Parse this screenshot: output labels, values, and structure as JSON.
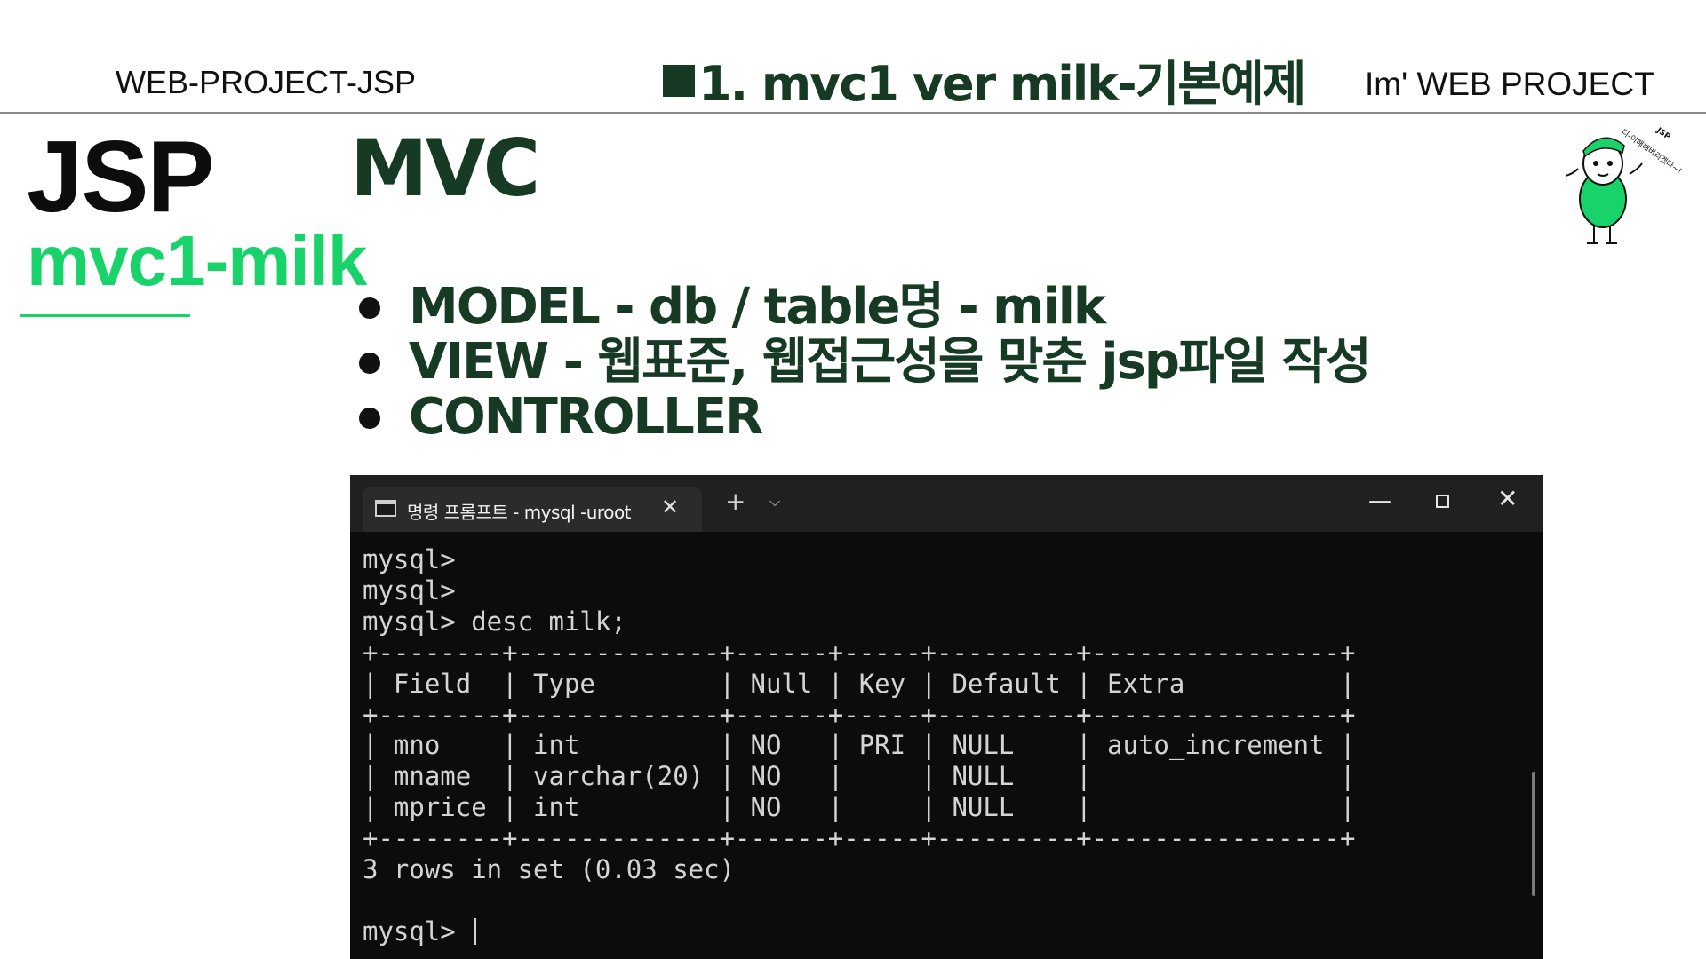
{
  "header": {
    "left": "WEB-PROJECT-JSP",
    "center": "1. mvc1 ver  milk-기본예제",
    "right": "Im'  WEB PROJECT"
  },
  "heading": {
    "jsp": "JSP",
    "mvc": "MVC",
    "sub": "mvc1-milk"
  },
  "bullets": [
    "MODEL - db / table명 - milk",
    "VIEW - 웹표준, 웹접근성을 맞춘 jsp파일 작성",
    "CONTROLLER"
  ],
  "mascot": {
    "text": "디-이해해버리겠다~!",
    "label": "JSP",
    "icon": "mascot-character"
  },
  "colors": {
    "accent_green": "#18d26a",
    "dark_green": "#173a24",
    "terminal_bg": "#0c0c0c"
  },
  "terminal": {
    "tab_title": "명령 프롬프트 - mysql  -uroot",
    "new_tab_label": "+",
    "lines": [
      "mysql>",
      "mysql>",
      "mysql> desc milk;",
      "+--------+-------------+------+-----+---------+----------------+",
      "| Field  | Type        | Null | Key | Default | Extra          |",
      "+--------+-------------+------+-----+---------+----------------+",
      "| mno    | int         | NO   | PRI | NULL    | auto_increment |",
      "| mname  | varchar(20) | NO   |     | NULL    |                |",
      "| mprice | int         | NO   |     | NULL    |                |",
      "+--------+-------------+------+-----+---------+----------------+",
      "3 rows in set (0.03 sec)",
      "",
      "mysql> "
    ]
  }
}
